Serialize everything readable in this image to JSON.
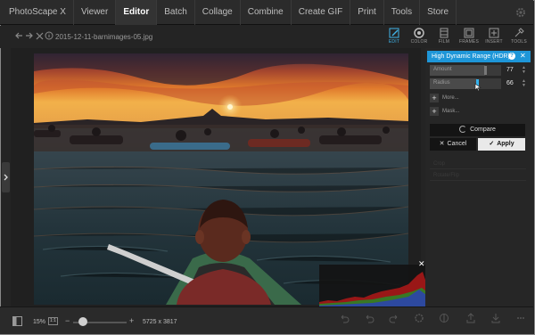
{
  "menu": {
    "items": [
      {
        "label": "PhotoScape X",
        "active": false
      },
      {
        "label": "Viewer",
        "active": false
      },
      {
        "label": "Editor",
        "active": true
      },
      {
        "label": "Batch",
        "active": false
      },
      {
        "label": "Collage",
        "active": false
      },
      {
        "label": "Combine",
        "active": false
      },
      {
        "label": "Create GIF",
        "active": false
      },
      {
        "label": "Print",
        "active": false
      },
      {
        "label": "Tools",
        "active": false
      },
      {
        "label": "Store",
        "active": false
      }
    ]
  },
  "toolbar": {
    "filename": "2015-12-11-barnimages-05.jpg",
    "tabs": [
      {
        "label": "EDIT",
        "icon": "edit-icon",
        "active": true
      },
      {
        "label": "COLOR",
        "icon": "color-icon",
        "active": false
      },
      {
        "label": "FILM",
        "icon": "film-icon",
        "active": false
      },
      {
        "label": "FRAMES",
        "icon": "frames-icon",
        "active": false
      },
      {
        "label": "INSERT",
        "icon": "insert-icon",
        "active": false
      },
      {
        "label": "TOOLS",
        "icon": "tools-icon",
        "active": false
      }
    ]
  },
  "panel": {
    "title": "High Dynamic Range (HDR)",
    "help": "?",
    "close": "✕",
    "amount": {
      "label": "Amount",
      "value": "77",
      "level": 0.77
    },
    "radius": {
      "label": "Radius",
      "value": "66",
      "level": 0.66
    },
    "more_label": "More...",
    "mask_label": "Mask...",
    "compare_label": "Compare",
    "cancel_label": "Cancel",
    "apply_label": "Apply",
    "faint_rows": [
      "Crop",
      "Rotate/Flip"
    ]
  },
  "histogram_close": "✕",
  "bottom": {
    "zoom": "15%",
    "zoom_level": 0.15,
    "fit_label": "1:1",
    "dimensions": "5725 x 3817"
  },
  "colors": {
    "accent": "#1e96d8",
    "apply_bg": "#e9e9e9"
  }
}
